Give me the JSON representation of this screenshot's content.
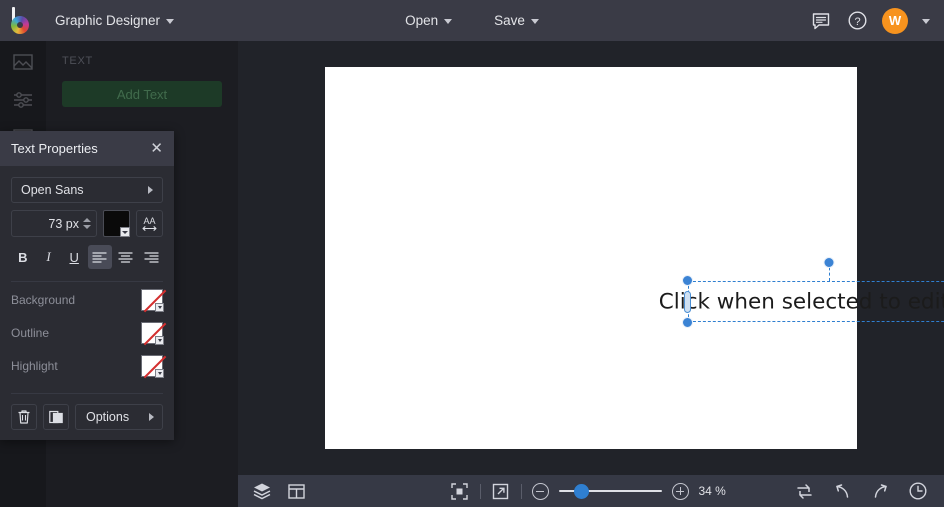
{
  "topbar": {
    "logo_icon": "brand-circle-logo",
    "document_title": "Graphic Designer",
    "open_label": "Open",
    "save_label": "Save",
    "chat_icon": "chat-bubble-icon",
    "help_icon": "help-circle-icon",
    "avatar_initial": "W"
  },
  "left_panel": {
    "section_label": "TEXT",
    "add_text_label": "Add Text",
    "rail_icons": [
      "image-icon",
      "adjustments-icon",
      "layers-panel-icon"
    ]
  },
  "text_properties": {
    "title": "Text Properties",
    "close_icon": "close-icon",
    "font_family": "Open Sans",
    "font_size": "73 px",
    "text_color": "#000000",
    "letter_spacing_icon": "letter-spacing-icon",
    "style_buttons": [
      {
        "name": "bold-button",
        "label": "B",
        "active": false
      },
      {
        "name": "italic-button",
        "label": "I",
        "active": false
      },
      {
        "name": "underline-button",
        "label": "U",
        "active": false
      }
    ],
    "align_buttons": [
      {
        "name": "align-left-button",
        "active": true
      },
      {
        "name": "align-center-button",
        "active": false
      },
      {
        "name": "align-right-button",
        "active": false
      }
    ],
    "properties": [
      {
        "label": "Background",
        "value": "none"
      },
      {
        "label": "Outline",
        "value": "none"
      },
      {
        "label": "Highlight",
        "value": "none"
      }
    ],
    "delete_icon": "trash-icon",
    "duplicate_icon": "duplicate-icon",
    "options_label": "Options"
  },
  "canvas": {
    "selected_text": "Click when selected to edit text",
    "selection_accent": "#2f7fd0",
    "page_background": "#ffffff"
  },
  "bottombar": {
    "layers_icon": "layers-icon",
    "template_icon": "template-grid-icon",
    "fit_icon": "fit-to-screen-icon",
    "fullscreen_icon": "expand-arrow-icon",
    "zoom_out_icon": "zoom-out-icon",
    "zoom_in_icon": "zoom-in-icon",
    "zoom_level": "34 %",
    "zoom_slider_percent": 18,
    "swap_icon": "swap-arrows-icon",
    "undo_icon": "undo-icon",
    "redo_icon": "redo-icon",
    "history_icon": "history-clock-icon"
  }
}
